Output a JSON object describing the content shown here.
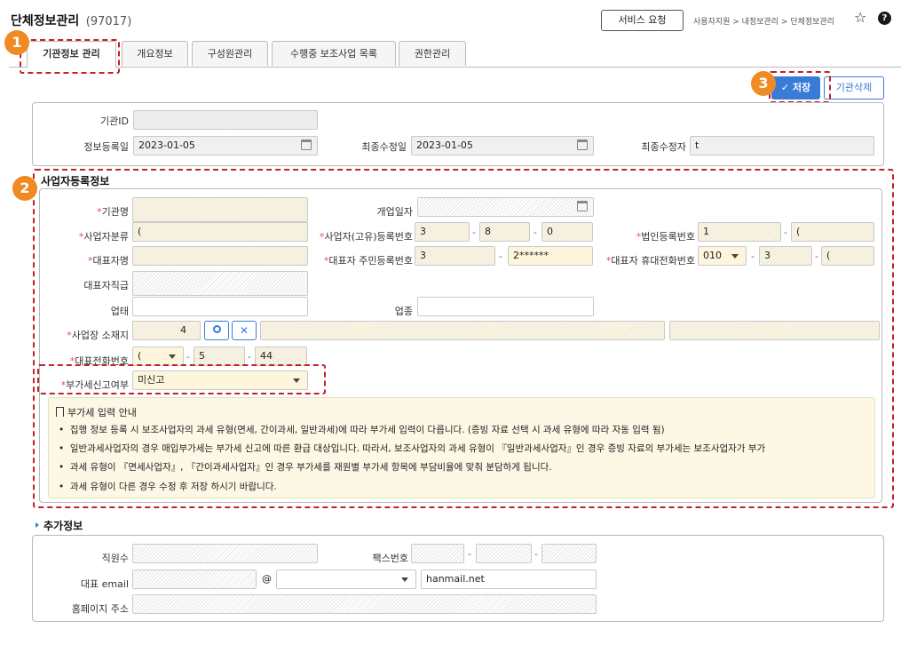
{
  "header": {
    "title": "단체정보관리",
    "code": "(97017)",
    "service_button": "서비스 요청",
    "breadcrumb": "사용자지원 > 내정보관리 > 단체정보관리"
  },
  "tabs": [
    {
      "label": "기관정보 관리",
      "active": true
    },
    {
      "label": "개요정보"
    },
    {
      "label": "구성원관리"
    },
    {
      "label": "수행중 보조사업 목록"
    },
    {
      "label": "권한관리"
    }
  ],
  "badges": {
    "one": "1",
    "two": "2",
    "three": "3"
  },
  "toolbar": {
    "save_label": "저장",
    "delete_label": "기관삭제"
  },
  "basic": {
    "org_id_label": "기관ID",
    "reg_date_label": "정보등록일",
    "reg_date": "2023-01-05",
    "mod_date_label": "최종수정일",
    "mod_date": "2023-01-05",
    "modifier_label": "최종수정자",
    "modifier": "t"
  },
  "business": {
    "section_title": "사업자등록정보",
    "org_name_label": "기관명",
    "open_date_label": "개업일자",
    "biz_type_label": "사업자분류",
    "biz_type_value": "(",
    "biz_no_label": "사업자(고유)등록번호",
    "biz_no_1": "3",
    "biz_no_2": "8",
    "biz_no_3": "0",
    "corp_no_label": "법인등록번호",
    "corp_no_1": "1",
    "corp_no_2": "(",
    "rep_name_label": "대표자명",
    "rep_rrn_label": "대표자 주민등록번호",
    "rep_rrn_1": "3",
    "rep_rrn_2": "2******",
    "rep_phone_label": "대표자 휴대전화번호",
    "rep_phone_1": "010",
    "rep_phone_2": "3",
    "rep_phone_3": "(",
    "rep_title_label": "대표자직급",
    "biz_kind_label": "업태",
    "biz_item_label": "업종",
    "address_label": "사업장 소재지",
    "address_zip": "4",
    "phone_label": "대표전화번호",
    "phone_1": "(",
    "phone_2": "5",
    "phone_3": "44",
    "vat_label": "부가세신고여부",
    "vat_value": "미신고"
  },
  "notice": {
    "title": "부가세 입력 안내",
    "items": [
      "집행 정보 등록 시 보조사업자의 과세 유형(면세, 간이과세, 일반과세)에 따라 부가세 입력이 다릅니다. (증빙 자료 선택 시 과세 유형에 따라 자동 입력 됨)",
      "일반과세사업자의 경우 매입부가세는 부가세 신고에 따른 환급 대상입니다. 따라서, 보조사업자의 과세 유형이 『일반과세사업자』인 경우 증빙 자료의 부가세는 보조사업자가 부가",
      "과세 유형이 『면세사업자』, 『간이과세사업자』인 경우 부가세를 재원별 부가세 항목에 부담비율에 맞춰 분담하게 됩니다.",
      "과세 유형이 다른 경우 수정 후 저장 하시기 바랍니다."
    ]
  },
  "extra": {
    "section_title": "추가정보",
    "staff_label": "직원수",
    "fax_label": "팩스번호",
    "email_label": "대표 email",
    "email_at": "@",
    "email_domain": "hanmail.net",
    "homepage_label": "홈페이지 주소"
  },
  "colors": {
    "accent": "#3b7bd8",
    "badge": "#f08a24",
    "highlight_red": "#c0212b",
    "required": "#e05252",
    "notice_bg": "#fdf8e6"
  }
}
